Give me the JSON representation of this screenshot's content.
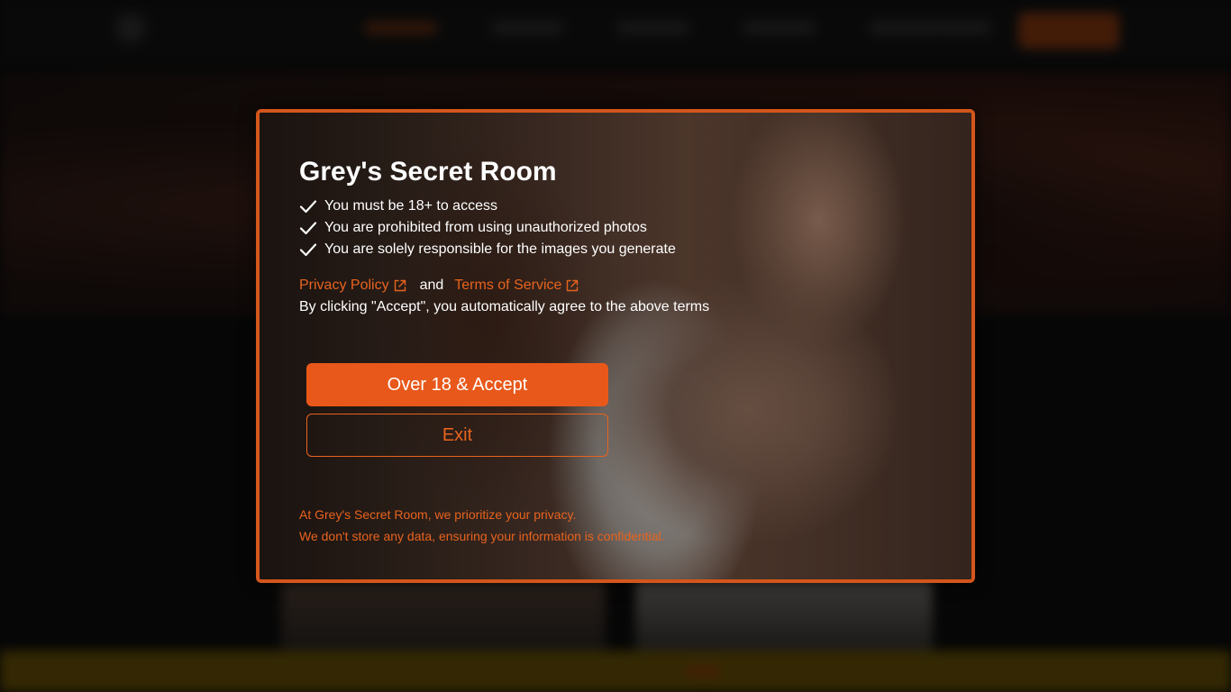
{
  "modal": {
    "title": "Grey's Secret Room",
    "terms": [
      "You must be 18+ to access",
      "You are prohibited from using unauthorized photos",
      "You are solely responsible for the images you generate"
    ],
    "privacy_link": "Privacy Policy",
    "and_text": "and",
    "terms_link": "Terms of Service",
    "agree_text": "By clicking \"Accept\", you automatically agree to the above terms",
    "accept_button": "Over 18 & Accept",
    "exit_button": "Exit",
    "privacy_note_line1": "At Grey's Secret Room, we prioritize your privacy.",
    "privacy_note_line2": "We don't store any data, ensuring your information is confidential."
  },
  "icons": {
    "check": "check-icon",
    "external_link": "external-link-icon"
  },
  "colors": {
    "accent": "#e8581a",
    "border": "#d4561c",
    "text": "#ffffff"
  }
}
